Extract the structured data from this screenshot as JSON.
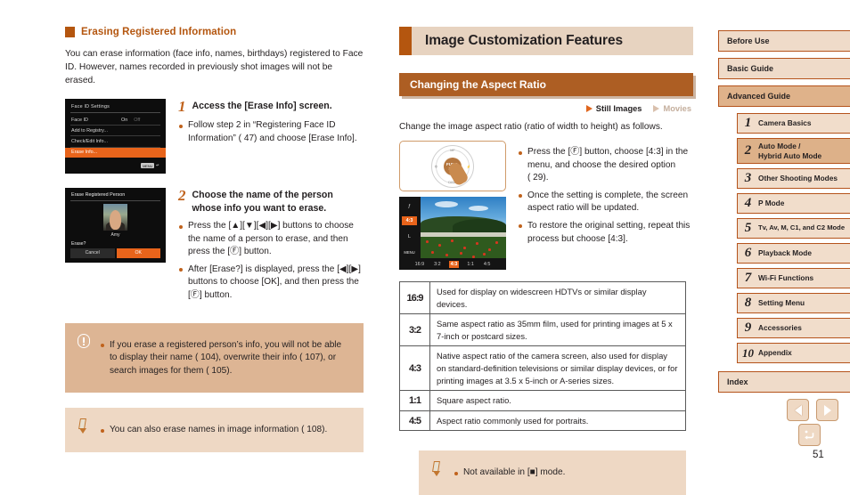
{
  "left": {
    "subhead": "Erasing Registered Information",
    "intro": "You can erase information (face info, names, birthdays) registered to Face ID. However, names recorded in previously shot images will not be erased.",
    "steps": [
      {
        "num": "1",
        "title": "Access the [Erase Info] screen.",
        "bullets": [
          "Follow step 2 in “Registering Face ID Information” ( 47) and choose [Erase Info]."
        ],
        "screen": {
          "title": "Face ID Settings",
          "items": [
            {
              "label": "Face ID",
              "value": "On",
              "value_off": "Off",
              "selected": false
            },
            {
              "label": "Add to Registry...",
              "value": "",
              "selected": false
            },
            {
              "label": "Check/Edit Info...",
              "value": "",
              "selected": false
            },
            {
              "label": "Erase Info...",
              "value": "",
              "selected": true
            }
          ],
          "footer_badge": "MENU"
        }
      },
      {
        "num": "2",
        "title": "Choose the name of the person whose info you want to erase.",
        "bullets": [
          "Press the [▲][▼][◀][▶] buttons to choose the name of a person to erase, and then press the [Ⓕ] button.",
          "After [Erase?] is displayed, press the [◀][▶] buttons to choose [OK], and then press the [Ⓕ] button."
        ],
        "screen": {
          "title": "Erase Registered Person",
          "person_name": "Amy",
          "prompt": "Erase?",
          "cancel": "Cancel",
          "ok": "OK"
        }
      }
    ],
    "warning": "If you erase a registered person’s info, you will not be able to display their name ( 104), overwrite their info ( 107), or search images for them ( 105).",
    "note": "You can also erase names in image information ( 108)."
  },
  "mid": {
    "chapter_title": "Image Customization Features",
    "section_title": "Changing the Aspect Ratio",
    "tags": {
      "still": "Still Images",
      "movies": "Movies"
    },
    "lead": "Change the image aspect ratio (ratio of width to height) as follows.",
    "bullets": [
      "Press the [Ⓕ] button, choose [4:3] in the menu, and choose the desired option ( 29).",
      "Once the setting is complete, the screen aspect ratio will be updated.",
      "To restore the original setting, repeat this process but choose [4:3]."
    ],
    "dial": {
      "hub_top": "FUNC.",
      "hub_bottom": "SET",
      "top": "MF",
      "bottom": "DISP.",
      "left": "⚙",
      "right": "⚡"
    },
    "lcd": {
      "left_items": [
        "ƒ",
        "4:3",
        "L",
        "MENU"
      ],
      "left_highlight_index": 1,
      "bottom_items": [
        "16:9",
        "3:2",
        "4:3",
        "1:1",
        "4:5"
      ],
      "bottom_highlight_index": 2
    },
    "table": {
      "rows": [
        {
          "ratio": "16:9",
          "desc": "Used for display on widescreen HDTVs or similar display devices."
        },
        {
          "ratio": "3:2",
          "desc": "Same aspect ratio as 35mm film, used for printing images at 5 x 7-inch or postcard sizes."
        },
        {
          "ratio": "4:3",
          "desc": "Native aspect ratio of the camera screen, also used for display on standard-definition televisions or similar display devices, or for printing images at 3.5 x 5-inch or A-series sizes."
        },
        {
          "ratio": "1:1",
          "desc": "Square aspect ratio."
        },
        {
          "ratio": "4:5",
          "desc": "Aspect ratio commonly used for portraits."
        }
      ]
    },
    "note": "Not available in [■] mode."
  },
  "sidebar": {
    "top_items": [
      {
        "label": "Before Use",
        "active": false
      },
      {
        "label": "Basic Guide",
        "active": false
      },
      {
        "label": "Advanced Guide",
        "active": true
      }
    ],
    "chapters": [
      {
        "num": "1",
        "label": "Camera Basics",
        "active": false
      },
      {
        "num": "2",
        "label": "Auto Mode /\nHybrid Auto Mode",
        "active": true
      },
      {
        "num": "3",
        "label": "Other Shooting Modes",
        "active": false
      },
      {
        "num": "4",
        "label": "P Mode",
        "active": false
      },
      {
        "num": "5",
        "label": "Tv, Av, M, C1, and C2 Mode",
        "active": false
      },
      {
        "num": "6",
        "label": "Playback Mode",
        "active": false
      },
      {
        "num": "7",
        "label": "Wi-Fi Functions",
        "active": false
      },
      {
        "num": "8",
        "label": "Setting Menu",
        "active": false
      },
      {
        "num": "9",
        "label": "Accessories",
        "active": false
      },
      {
        "num": "10",
        "label": "Appendix",
        "active": false
      }
    ],
    "index": "Index"
  },
  "footer": {
    "page_number": "51",
    "prev_icon": "left-arrow-icon",
    "next_icon": "right-arrow-icon",
    "home_icon": "return-home-icon"
  },
  "colors": {
    "accent_orange": "#b4560f",
    "section_bar": "#ad5e23",
    "chapter_bg": "#e7d3c0",
    "warning_bg": "#ddb594",
    "note_bg": "#eed8c4",
    "highlight": "#e8641b",
    "nav_border": "#b5531b",
    "nav_bg": "#efdbc9",
    "nav_active": "#ddb189"
  }
}
